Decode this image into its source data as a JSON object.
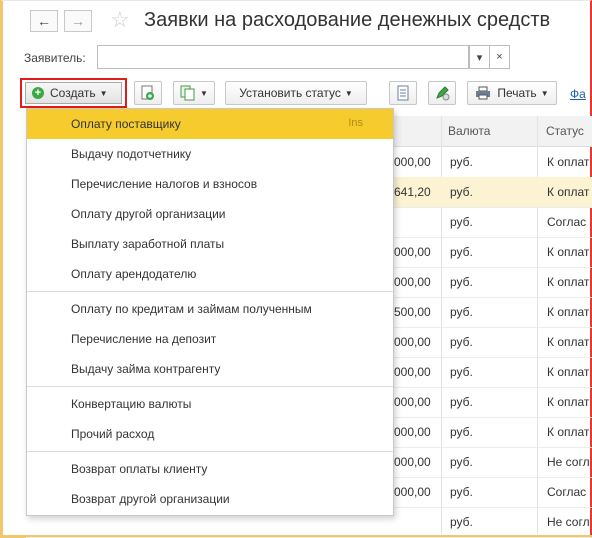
{
  "window": {
    "title": "Заявки на расходование денежных средств"
  },
  "nav": {
    "back": "←",
    "forward": "→"
  },
  "filter": {
    "label": "Заявитель:",
    "value": "",
    "dropdown": "▾",
    "clear": "×"
  },
  "toolbar": {
    "create_label": "Создать",
    "set_status_label": "Установить статус",
    "print_label": "Печать",
    "link_label": "Фа"
  },
  "table": {
    "headers": {
      "currency": "Валюта",
      "status": "Статус"
    },
    "rows": [
      {
        "amount": "000,00",
        "currency": "руб.",
        "status": "К оплат"
      },
      {
        "amount": "641,20",
        "currency": "руб.",
        "status": "К оплат"
      },
      {
        "amount": "",
        "currency": "руб.",
        "status": "Соглас"
      },
      {
        "amount": "000,00",
        "currency": "руб.",
        "status": "К оплат"
      },
      {
        "amount": "000,00",
        "currency": "руб.",
        "status": "К оплат"
      },
      {
        "amount": "500,00",
        "currency": "руб.",
        "status": "К оплат"
      },
      {
        "amount": "000,00",
        "currency": "руб.",
        "status": "К оплат"
      },
      {
        "amount": "000,00",
        "currency": "руб.",
        "status": "К оплат"
      },
      {
        "amount": "000,00",
        "currency": "руб.",
        "status": "К оплат"
      },
      {
        "amount": "000,00",
        "currency": "руб.",
        "status": "К оплат"
      },
      {
        "amount": "000,00",
        "currency": "руб.",
        "status": "Не согл"
      },
      {
        "amount": "000,00",
        "currency": "руб.",
        "status": "Соглас"
      },
      {
        "amount": "",
        "currency": "руб.",
        "status": "Не согл"
      }
    ]
  },
  "menu": {
    "items": [
      {
        "label": "Оплату поставщику",
        "shortcut": "Ins"
      },
      {
        "label": "Выдачу подотчетнику"
      },
      {
        "label": "Перечисление налогов и взносов"
      },
      {
        "label": "Оплату другой организации"
      },
      {
        "label": "Выплату заработной платы"
      },
      {
        "label": "Оплату арендодателю"
      },
      {
        "label": "Оплату по кредитам и займам полученным"
      },
      {
        "label": "Перечисление на депозит"
      },
      {
        "label": "Выдачу займа контрагенту"
      },
      {
        "label": "Конвертацию валюты"
      },
      {
        "label": "Прочий расход"
      },
      {
        "label": "Возврат оплаты клиенту"
      },
      {
        "label": "Возврат другой организации"
      }
    ]
  }
}
